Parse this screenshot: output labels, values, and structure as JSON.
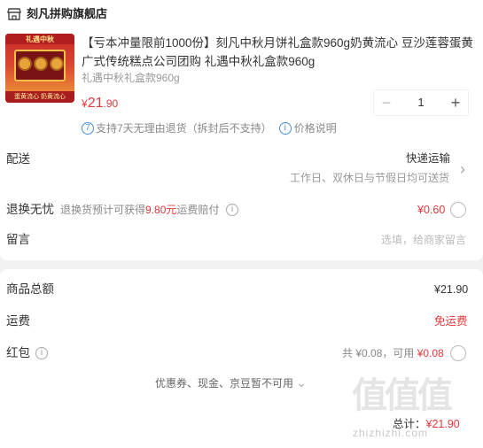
{
  "shop": {
    "name": "刻凡拼购旗舰店"
  },
  "product": {
    "thumb_text": "礼遇中秋",
    "thumb_foot": "蛋黄流心 奶黄流心",
    "title": "【亏本冲量限前1000份】刻凡中秋月饼礼盒款960g奶黄流心 豆沙莲蓉蛋黄广式传统糕点公司团购 礼遇中秋礼盒款960g",
    "variant": "礼遇中秋礼盒款960g",
    "price_symbol": "¥",
    "price_int": "21",
    "price_dec": ".90",
    "quantity": "1",
    "minus": "−",
    "plus": "+",
    "return_icon": "7",
    "return_policy": "支持7天无理由退货（拆封后不支持）",
    "price_info_icon": "i",
    "price_info": "价格说明"
  },
  "delivery": {
    "label": "配送",
    "method": "快递运输",
    "detail": "工作日、双休日与节假日均可送货",
    "chevron": "›"
  },
  "swap": {
    "label": "退换无忧",
    "desc_prefix": "退换货预计可获得",
    "desc_amount": "9.80元",
    "desc_suffix": "运费赔付",
    "info_icon": "i",
    "price": "¥0.60"
  },
  "message": {
    "label": "留言",
    "placeholder": "选填，给商家留言"
  },
  "summary": {
    "total_label": "商品总额",
    "total_value": "¥21.90",
    "shipping_label": "运费",
    "shipping_value": "免运费",
    "redpacket_label": "红包",
    "redpacket_info_icon": "i",
    "redpacket_total": "共 ¥0.08，可用",
    "redpacket_available": "¥0.08",
    "coupons_note": "优惠券、现金、京豆暂不可用",
    "coupons_chevron": "⌄",
    "grand_label": "总计：",
    "grand_value": "¥21.90"
  },
  "watermark": {
    "logo": "值值值",
    "site": "zhizhizhi.com"
  },
  "colors": {
    "accent": "#e4393c",
    "link": "#4a8fd9",
    "background": "#f2f2f2"
  }
}
